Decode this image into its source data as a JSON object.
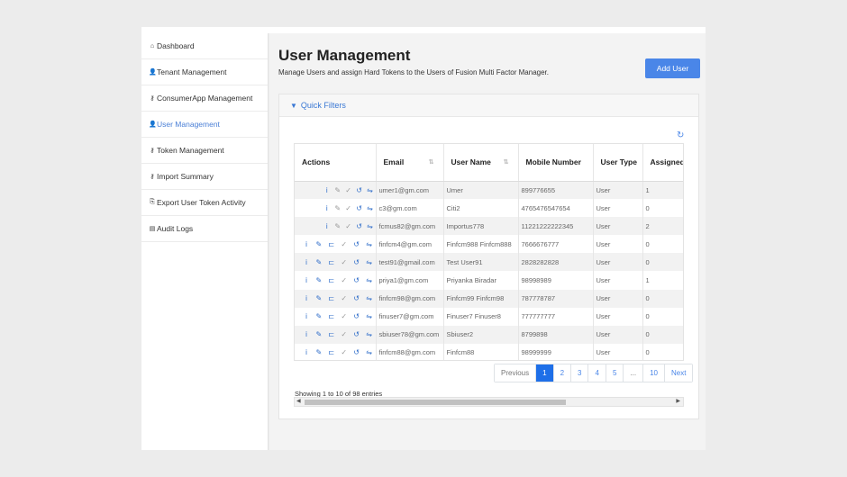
{
  "sidebar": {
    "items": [
      {
        "icon": "home-icon",
        "glyph": "⌂",
        "label": "Dashboard"
      },
      {
        "icon": "person-icon",
        "glyph": "👤",
        "label": "Tenant Management"
      },
      {
        "icon": "key-icon",
        "glyph": "⚷",
        "label": "ConsumerApp Management"
      },
      {
        "icon": "person-icon",
        "glyph": "👤",
        "label": "User Management",
        "active": true
      },
      {
        "icon": "key-icon",
        "glyph": "⚷",
        "label": "Token Management"
      },
      {
        "icon": "key-icon",
        "glyph": "⚷",
        "label": "Import Summary"
      },
      {
        "icon": "export-icon",
        "glyph": "⎘",
        "label": "Export User Token Activity"
      },
      {
        "icon": "log-icon",
        "glyph": "▤",
        "label": "Audit Logs"
      }
    ]
  },
  "header": {
    "title": "User Management",
    "subtitle": "Manage Users and assign Hard Tokens to the Users of Fusion Multi Factor Manager.",
    "add_label": "Add User"
  },
  "filters": {
    "label": "Quick Filters"
  },
  "table": {
    "columns": [
      "Actions",
      "Email",
      "User Name",
      "Mobile Number",
      "User Type",
      "Assigned"
    ],
    "rows": [
      {
        "email": "umer1@gm.com",
        "name": "Umer",
        "mobile": "899776655",
        "type": "User",
        "assigned": "1",
        "assignable": false
      },
      {
        "email": "c3@gm.com",
        "name": "Citi2",
        "mobile": "4765476547654",
        "type": "User",
        "assigned": "0",
        "assignable": false
      },
      {
        "email": "fcmus82@gm.com",
        "name": "Importus778",
        "mobile": "11221222222345",
        "type": "User",
        "assigned": "2",
        "assignable": false
      },
      {
        "email": "finfcm4@gm.com",
        "name": "Finfcm988 Finfcm888",
        "mobile": "7666676777",
        "type": "User",
        "assigned": "0",
        "assignable": true
      },
      {
        "email": "test91@gmail.com",
        "name": "Test User91",
        "mobile": "2828282828",
        "type": "User",
        "assigned": "0",
        "assignable": true
      },
      {
        "email": "priya1@gm.com",
        "name": "Priyanka Biradar",
        "mobile": "98998989",
        "type": "User",
        "assigned": "1",
        "assignable": true
      },
      {
        "email": "finfcm98@gm.com",
        "name": "Finfcm99 Finfcm98",
        "mobile": "787778787",
        "type": "User",
        "assigned": "0",
        "assignable": true
      },
      {
        "email": "finuser7@gm.com",
        "name": "Finuser7 Finuser8",
        "mobile": "777777777",
        "type": "User",
        "assigned": "0",
        "assignable": true
      },
      {
        "email": "sbiuser78@gm.com",
        "name": "Sbiuser2",
        "mobile": "8799898",
        "type": "User",
        "assigned": "0",
        "assignable": true
      },
      {
        "email": "finfcm88@gm.com",
        "name": "Finfcm88",
        "mobile": "98999999",
        "type": "User",
        "assigned": "0",
        "assignable": true
      }
    ]
  },
  "pagination": {
    "pages": [
      "Previous",
      "1",
      "2",
      "3",
      "4",
      "5",
      "...",
      "10",
      "Next"
    ],
    "active": "1",
    "showing": "Showing 1 to 10 of 98 entries"
  },
  "colors": {
    "accent": "#4a86e8",
    "active_page": "#1e6fe8",
    "sidebar_active": "#4a7fd6"
  }
}
